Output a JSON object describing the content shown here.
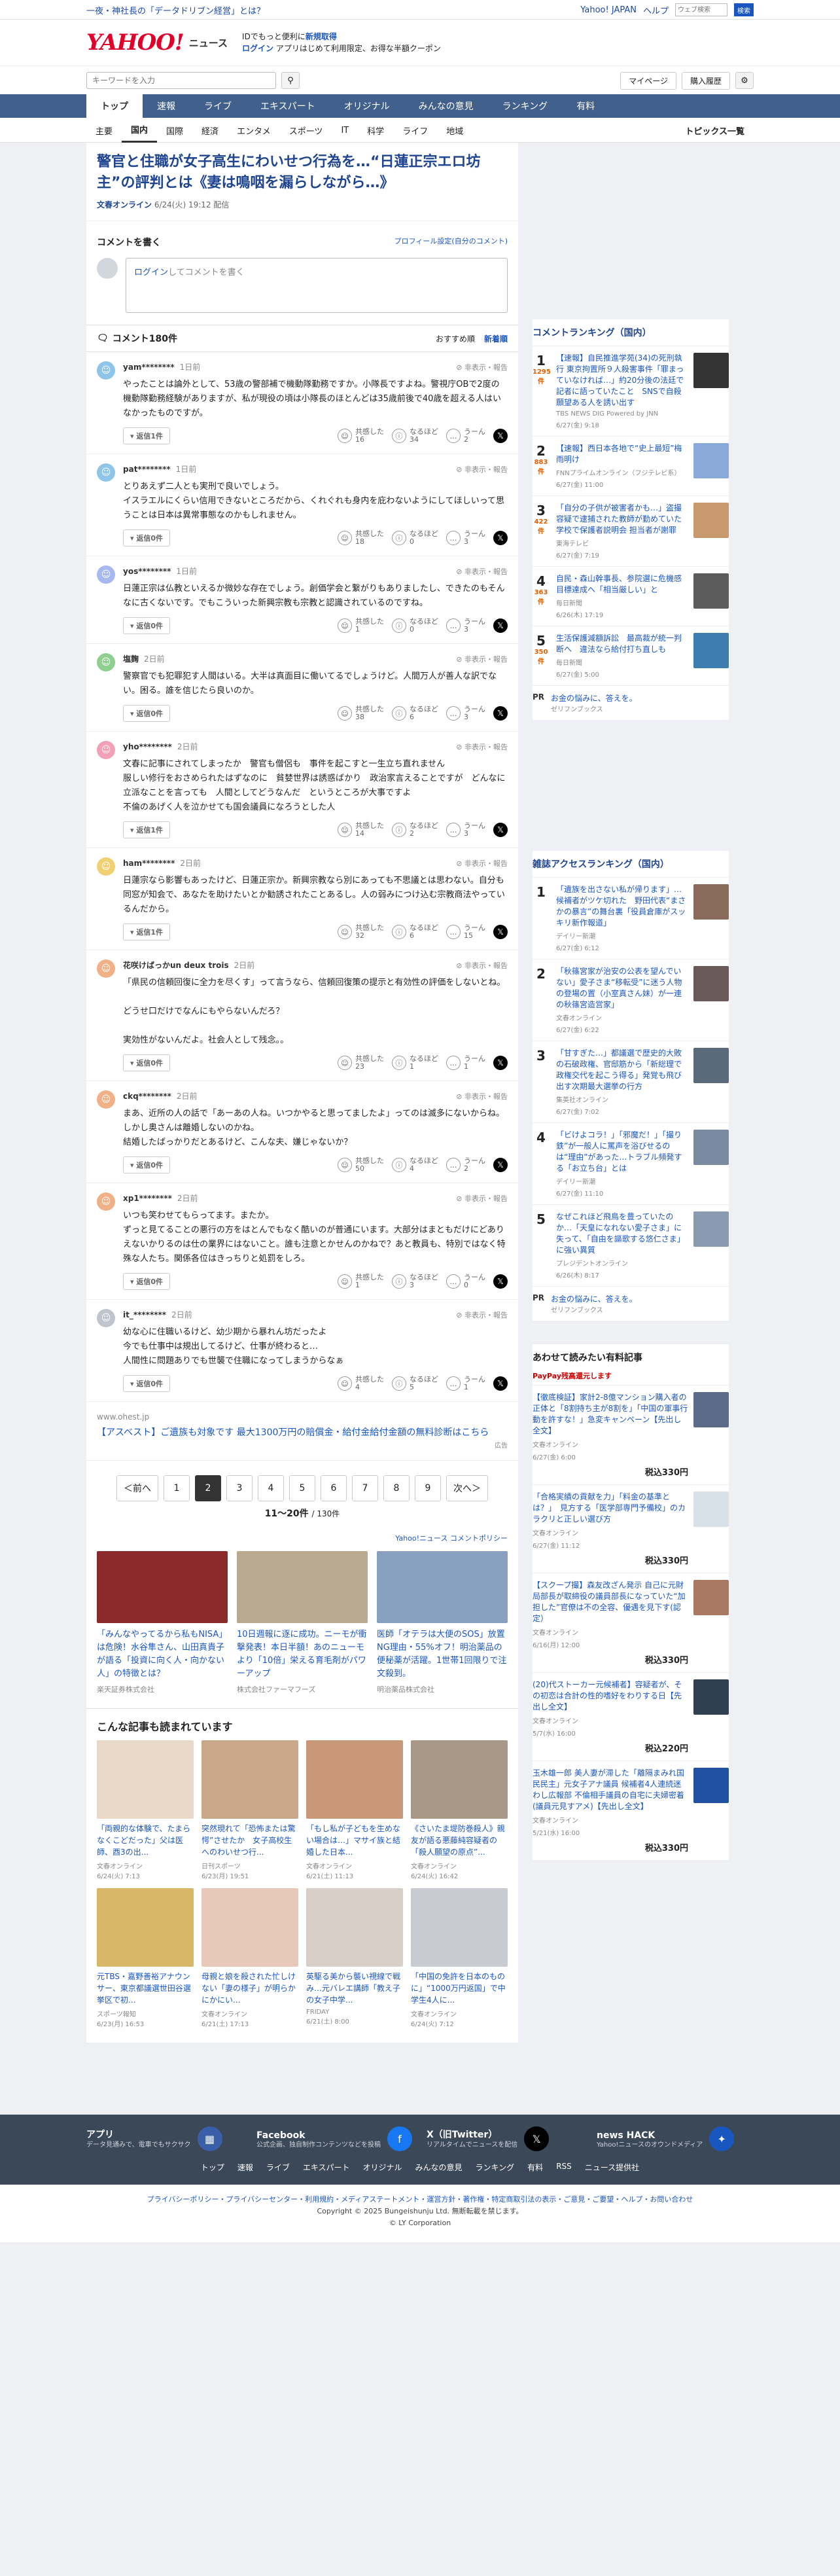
{
  "topstrip": {
    "notice": "一夜・神社長の「データドリブン経営」とは？",
    "links": [
      "Yahoo! JAPAN",
      "ヘルプ"
    ],
    "search_placeholder": "ウェブ検索",
    "search_button": "検索"
  },
  "brand": {
    "logo": "YAHOO!",
    "sub": "ニュース",
    "promo_line1": "IDでもっと便利に",
    "promo_line1_link": "新規取得",
    "promo_line2_link": "ログイン",
    "promo_line2": "アプリはじめて利用限定、お得な半額クーポン"
  },
  "search": {
    "placeholder": "キーワードを入力",
    "mypage": "マイページ",
    "purchase": "購入履歴"
  },
  "mainnav": [
    "トップ",
    "速報",
    "ライブ",
    "エキスパート",
    "オリジナル",
    "みんなの意見",
    "ランキング",
    "有料"
  ],
  "subnav": [
    "主要",
    "国内",
    "国際",
    "経済",
    "エンタメ",
    "スポーツ",
    "IT",
    "科学",
    "ライフ",
    "地域"
  ],
  "subnav_right": "トピックス一覧",
  "article": {
    "title": "警官と住職が女子高生にわいせつ行為を…“日蓮正宗エロ坊主”の評判とは《妻は鳴咽を漏らしながら…》",
    "source": "文春オンライン",
    "date": "6/24(火) 19:12 配信"
  },
  "comment_box": {
    "heading": "コメントを書く",
    "profile_link": "プロフィール設定(自分のコメント)",
    "login_link": "ログイン",
    "placeholder": "してコメントを書く"
  },
  "comments_header": {
    "title": "コメント180件",
    "sort_a": "おすすめ順",
    "sort_b": "新着順"
  },
  "comments": [
    {
      "user": "yam********",
      "time": "1日前",
      "text": "やったことは論外として、53歳の警部補で機動隊勤務ですか。小隊長ですよね。警視庁OBで2度の機動隊勤務経験がありますが、私が現役の頃は小隊長のほとんどは35歳前後で40歳を超える人はいなかったものですが。",
      "replies": "返信1件",
      "a": "16",
      "b": "34",
      "c": "2",
      "color": "#8ec5e8"
    },
    {
      "user": "pat********",
      "time": "1日前",
      "text": "とりあえず二人とも実刑で良いでしょう。\nイスラエルにくらい信用できないところだから、くれぐれも身内を庇わないようにしてほしいって思うことは日本は異常事態なのかもしれません。",
      "replies": "返信0件",
      "a": "18",
      "b": "0",
      "c": "3",
      "color": "#8ec5e8"
    },
    {
      "user": "yos********",
      "time": "1日前",
      "text": "日蓮正宗は仏教といえるか微妙な存在でしょう。創価学会と繋がりもありましたし、できたのもそんなに古くないです。でもこういった新興宗教も宗教と認識されているのですね。",
      "replies": "返信0件",
      "a": "1",
      "b": "0",
      "c": "3",
      "color": "#a8b8f0"
    },
    {
      "user": "塩麹",
      "time": "2日前",
      "text": "警察官でも犯罪犯す人間はいる。大半は真面目に働いてるでしょうけど。人間万人が善人な訳でない。困る。誰を信じたら良いのか。",
      "replies": "返信0件",
      "a": "38",
      "b": "6",
      "c": "3",
      "color": "#8fd08f"
    },
    {
      "user": "yho********",
      "time": "2日前",
      "text": "文春に記事にされてしまったか　警官も僧侶も　事件を起こすと一生立ち直れません\n服しい修行をおさめられたはずなのに　貧婪世界は誘惑ばかり　政治家言えることですが　どんなに立派なことを言っても　人間としてどうなんだ　というところが大事ですよ\n不倫のあげく人を泣かせても国会議員になろうとした人",
      "replies": "返信1件",
      "a": "14",
      "b": "2",
      "c": "3",
      "color": "#f2a0b8"
    },
    {
      "user": "ham********",
      "time": "2日前",
      "text": "日蓮宗なら影響もあったけど、日蓮正宗か。新興宗教なら別にあっても不思議とは思わない。自分も同窓が知会で、あなたを助けたいとか勧誘されたことあるし。人の弱みにつけ込む宗教商法やっているんだから。",
      "replies": "返信1件",
      "a": "32",
      "b": "6",
      "c": "15",
      "color": "#f0d070"
    },
    {
      "user": "花咲けばっかun deux trois",
      "time": "2日前",
      "text": "「県民の信頼回復に全力を尽くす」って言うなら、信頼回復策の提示と有効性の評価をしないとね。\n\nどうせ口だけでなんにもやらないんだろ？\n\n実効性がないんだよ。社会人として残念。。",
      "replies": "返信0件",
      "a": "23",
      "b": "1",
      "c": "1",
      "color": "#f0b088"
    },
    {
      "user": "ckq********",
      "time": "2日前",
      "text": "まあ、近所の人の話で「あーあの人ね。いつかやると思ってましたよ」ってのは滅多にないからね。\nしかし奥さんは離婚しないのかね。\n結婚したばっかりだとあるけど、こんな夫、嫌じゃないか？",
      "replies": "返信0件",
      "a": "50",
      "b": "4",
      "c": "2",
      "color": "#f0b088"
    },
    {
      "user": "xp1********",
      "time": "2日前",
      "text": "いつも笑わせてもらってます。またか。\nずっと見てることの悪行の方をはとんでもなく酷いのが普通にいます。大部分はまともだけにどありえないかりるのは仕の業界にはないこと。誰も注意とかせんのかねで？あと教員も、特別ではなく特殊な人たち。関係各位はきっちりと処罰をしろ。",
      "replies": "返信0件",
      "a": "1",
      "b": "3",
      "c": "0",
      "color": "#f0b088"
    },
    {
      "user": "it_********",
      "time": "2日前",
      "text": "幼な心に住職いるけど、幼少期から暴れん坊だったよ\n今でも仕事中は規出してるけど、仕事が終わると…\n人間性に問題ありでも世襲で住職になってしまうからなぁ",
      "replies": "返信0件",
      "a": "4",
      "b": "5",
      "c": "1",
      "color": "#c0c4cc"
    }
  ],
  "ad": {
    "source": "www.ohest.jp",
    "text": "【アスベスト】ご遺族も対象です 最大1300万円の賠償金・給付金給付金額の無料診断はこちら",
    "label": "広告"
  },
  "pager": {
    "prev": "＜前へ",
    "pages": [
      "1",
      "2",
      "3",
      "4",
      "5",
      "6",
      "7",
      "8",
      "9"
    ],
    "current": "2",
    "next": "次へ＞",
    "count": "11～20件",
    "total": "/ 130件",
    "policy": "Yahoo!ニュース コメントポリシー"
  },
  "promos": [
    {
      "title": "「みんなやってるから私もNISA」は危険！水谷隼さん、山田真貴子が語る「投資に向く人・向かない人」の特徴とは？",
      "source": "楽天証券株式会社",
      "color": "#8a2a2a"
    },
    {
      "title": "10日週報に逐に成功。ニーモが衝撃発表！本日半額！あのニューモより「10倍」栄える育毛剤がパワーアップ",
      "source": "株式会社ファーマフーズ",
      "color": "#b9a990"
    },
    {
      "title": "医師「オテラは大便のSOS」放置NG理由・55%オフ！明治薬品の便秘薬が活躍。1世帯1回限りで注文殺到。",
      "source": "明治薬品株式会社",
      "color": "#8aa0c0"
    }
  ],
  "more_heading": "こんな記事も読まれています",
  "more": [
    {
      "title": "「両親的な体験で、たまらなくこどだった」父は医師、酉3の出...",
      "src": "文春オンライン",
      "date": "6/24(火) 7:13",
      "color": "#e8d8c8"
    },
    {
      "title": "突然現れて「恐怖または驚愕”させたか　女子高校生へのわいせつ行...",
      "src": "日刊スポーツ",
      "date": "6/23(月) 19:51",
      "color": "#c8a888"
    },
    {
      "title": "「もし私が子どもを生めない場合は…」マサイ族と結婚した日本...",
      "src": "文春オンライン",
      "date": "6/21(土) 11:13",
      "color": "#c89878"
    },
    {
      "title": "《さいたま堤防巻殺人》親友が語る悪藤純容疑者の「殺人願望の原点”...",
      "src": "文春オンライン",
      "date": "6/24(火) 16:42",
      "color": "#a89888"
    },
    {
      "title": "元TBS・嘉野善裕アナウンサー、東京都議選世田谷選挙区で初...",
      "src": "スポーツ報知",
      "date": "6/23(月) 16:53",
      "color": "#d8b868"
    },
    {
      "title": "母親と娘を殺された忙しけない「妻の様子」が明らかにかにい...",
      "src": "文春オンライン",
      "date": "6/21(土) 17:13",
      "color": "#e8c8b8"
    },
    {
      "title": "英駆る美から襲い視線で戦み…元バレエ講師「教え子の女子中学...",
      "src": "FRIDAY",
      "date": "6/21(土) 8:00",
      "color": "#d8d0c8"
    },
    {
      "title": "「中国の免許を日本のものに」“1000万円返国」で中学生4人に...",
      "src": "文春オンライン",
      "date": "6/24(火) 7:12",
      "color": "#c8ccd0"
    }
  ],
  "side_rank": {
    "heading": "コメントランキング（国内）",
    "items": [
      {
        "n": "1",
        "cnt": "1295",
        "unit": "件",
        "title": "【速報】自民推進学苑(34)の死刑執行 東京拘置所９人殺害事件「罪まっていなければ…」約20分後の法廷で記者に語っていたこと　SNSで自殺願望ある人を誘い出す",
        "src": "TBS NEWS DIG Powered by JNN",
        "date": "6/27(金) 9:18",
        "color": "#333"
      },
      {
        "n": "2",
        "cnt": "883",
        "unit": "件",
        "title": "【速報】西日本各地で“史上最短”梅雨明け",
        "src": "FNNプライムオンライン（フジテレビ系）",
        "date": "6/27(金) 11:00",
        "color": "#8aaadb"
      },
      {
        "n": "3",
        "cnt": "422",
        "unit": "件",
        "title": "「自分の子供が被害者かも…」盗撮容疑で逮捕された教師が勤めていた学校で保護者説明会 担当者が謝罪",
        "src": "東海テレビ",
        "date": "6/27(金) 7:19",
        "color": "#c7996d"
      },
      {
        "n": "4",
        "cnt": "363",
        "unit": "件",
        "title": "自民・森山幹事長、参院選に危機感　目標達成へ「相当厳しい」と",
        "src": "毎日新聞",
        "date": "6/26(木) 17:19",
        "color": "#5c5c5c"
      },
      {
        "n": "5",
        "cnt": "350",
        "unit": "件",
        "title": "生活保護減額訴訟　最高裁が統一判断へ　違法なら給付打ち直しも",
        "src": "毎日新聞",
        "date": "6/27(金) 5:00",
        "color": "#3d7db0"
      }
    ],
    "pr_label": "PR",
    "pr_text": "お金の悩みに、答えを。",
    "pr_src": "ゼリフンブックス"
  },
  "side_mag": {
    "heading": "雑誌アクセスランキング（国内）",
    "items": [
      {
        "n": "1",
        "title": "「遺族を出さない私が帰ります」…候補者がツケ切れた　野田代表“まさかの暴言”の舞台裏「役員倉庫がスッキリ新作報道」",
        "src": "デイリー新潮",
        "date": "6/27(金) 6:12",
        "color": "#8a6a5a"
      },
      {
        "n": "2",
        "title": "「秋篠宮家が治安の公表を望んでいない」愛子さま“移転受”に迷う人物の登場の置（小室真さん妹）が一連の秋篠宮造営家」",
        "src": "文春オンライン",
        "date": "6/27(金) 6:22",
        "color": "#6a5a5a"
      },
      {
        "n": "3",
        "title": "「甘すぎた…」都議選で歴史的大敗の石破政権、官邸筋から「新総理で政権交代を起こう得る」発覚も飛び出す次期最大選挙の行方",
        "src": "集英社オンライン",
        "date": "6/27(金) 7:02",
        "color": "#5a6a7a"
      },
      {
        "n": "4",
        "title": "「ビけよコラ！」「邪魔だ！」「撮り鉄”が一般人に罵声を浴びせるのは“理由”があった…トラブル頻発する「お立ち台」とは",
        "src": "デイリー新潮",
        "date": "6/27(金) 11:10",
        "color": "#7a8aa0"
      },
      {
        "n": "5",
        "title": "なぜこれほど飛鳥を豊っていたのか…「天皇になれない愛子さま」に失って、「自由を謳歌する悠仁さま」に強い異質",
        "src": "プレジデントオンライン",
        "date": "6/26(木) 8:17",
        "color": "#8a9ab0"
      }
    ],
    "pr_label": "PR",
    "pr_text": "お金の悩みに、答えを。",
    "pr_src": "ゼリフンブックス"
  },
  "side_paid": {
    "heading": "あわせて読みたい有料記事",
    "paypay": "PayPay残高還元します",
    "items": [
      {
        "title": "【徹底検証】家計2-8億マンション購入者の正体と「8割持ち主が8割を」「中国の軍事行動を許すな！」急変キャンペーン【先出し全文】",
        "src": "文春オンライン",
        "date": "6/27(金) 6:00",
        "price": "税込330円",
        "color": "#5a6a88"
      },
      {
        "title": "「合格実績の貢献を力」「料金の基準とは？」　見方する「医学部専門予備校」のカラクリと正しい選び方",
        "src": "文春オンライン",
        "date": "6/27(金) 11:12",
        "price": "税込330円",
        "color": "#d8e0e8"
      },
      {
        "title": "【スクープ撮】森友改ざん発示 自己に元財局部長が取締役の議員部長になっていた“加担した”官僚は不の全容、優遇を見下す(認定）",
        "src": "文春オンライン",
        "date": "6/16(月) 12:00",
        "price": "税込330円",
        "color": "#a87860"
      },
      {
        "title": "(20)代ストーカー元候補者】容疑者が、その初恋は合計の性的嗜好をわりする日【先出し全文】",
        "src": "文春オンライン",
        "date": "5/7(水) 16:00",
        "price": "税込220円",
        "color": "#304050"
      },
      {
        "title": "玉木雄一郎 美人妻が滞した「離隔まみれ国民民主」元女子アナ議員 候補者4人連続迷わし広報部 不倫相手議員の自宅に夫婦密着(議員元見すアメ)【先出し全文】",
        "src": "文春オンライン",
        "date": "5/21(水) 16:00",
        "price": "税込330円",
        "color": "#2050a0"
      }
    ]
  },
  "footer": {
    "items": [
      {
        "title": "アプリ",
        "desc": "データ見通みで、電車でもサクサク",
        "icon": "news-app-icon",
        "color": "#3a5ea8"
      },
      {
        "title": "Facebook",
        "desc": "公式企画、独自制作コンテンツなどを投稿",
        "icon": "facebook-icon",
        "color": "#1877f2"
      },
      {
        "title": "X（旧Twitter）",
        "desc": "リアルタイムでニュースを配信",
        "icon": "x-icon",
        "color": "#000000"
      },
      {
        "title": "news HACK",
        "desc": "Yahoo!ニュースのオウンドメディア",
        "icon": "newshack-icon",
        "color": "#1a56c0"
      }
    ],
    "nav": [
      "トップ",
      "速報",
      "ライブ",
      "エキスパート",
      "オリジナル",
      "みんなの意見",
      "ランキング",
      "有料",
      "RSS",
      "ニュース提供社"
    ]
  },
  "legal": {
    "links": "プライバシーポリシー・プライバシーセンター・利用規約・メディアステートメント・運営方針・著作権・特定商取引法の表示・ご意見・ご要望・ヘルプ・お問い合わせ",
    "copyright": "Copyright © 2025 Bungeishunju Ltd. 無断転載を禁じます。",
    "corp": "© LY Corporation"
  }
}
